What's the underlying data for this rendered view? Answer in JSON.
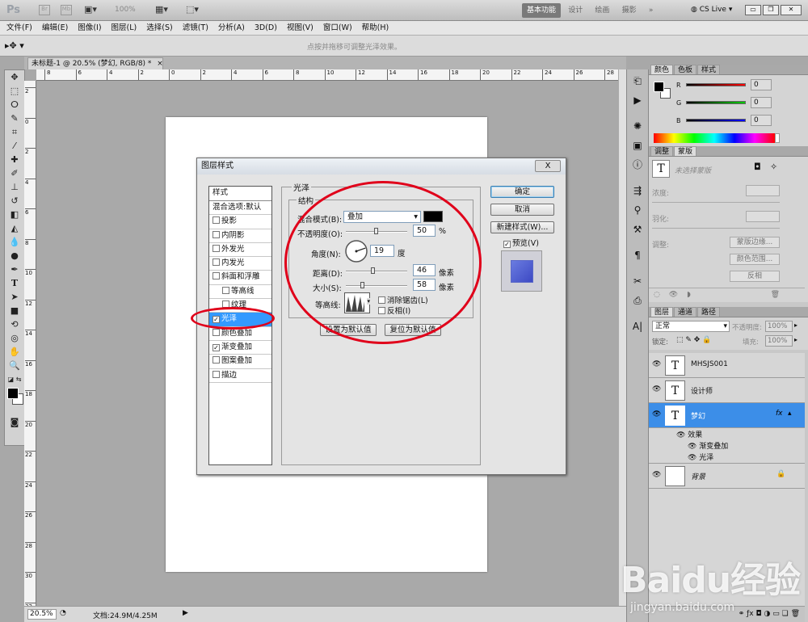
{
  "app": {
    "logo": "Ps",
    "zoom_display": "100%",
    "workspaces": [
      "基本功能",
      "设计",
      "绘画",
      "摄影"
    ],
    "more": "»",
    "cslive": "CS Live"
  },
  "menu": [
    "文件(F)",
    "编辑(E)",
    "图像(I)",
    "图层(L)",
    "选择(S)",
    "滤镜(T)",
    "分析(A)",
    "3D(D)",
    "视图(V)",
    "窗口(W)",
    "帮助(H)"
  ],
  "options": {
    "hint": "点按并拖移可调整光泽效果。"
  },
  "doc_tab": {
    "label": "未标题-1 @ 20.5% (梦幻, RGB/8) *",
    "close": "×"
  },
  "ruler": {
    "top": [
      "8",
      "6",
      "4",
      "2",
      "0",
      "2",
      "4",
      "6",
      "8",
      "10",
      "12",
      "14",
      "16",
      "18",
      "20",
      "22",
      "24",
      "26",
      "28"
    ],
    "left": [
      "2",
      "0",
      "2",
      "4",
      "6",
      "8",
      "10",
      "12",
      "14",
      "16",
      "18",
      "20",
      "22",
      "24",
      "26",
      "28",
      "30",
      "32"
    ]
  },
  "status": {
    "zoom": "20.5%",
    "doc": "文档:24.9M/4.25M"
  },
  "color_panel": {
    "tabs": [
      "颜色",
      "色板",
      "样式"
    ],
    "channels": [
      {
        "label": "R",
        "value": "0"
      },
      {
        "label": "G",
        "value": "0"
      },
      {
        "label": "B",
        "value": "0"
      }
    ]
  },
  "adjust_panel": {
    "tabs": [
      "调整",
      "蒙版"
    ],
    "mask_hint": "未选择蒙版",
    "density": "浓度:",
    "feather": "羽化:",
    "refine": "调整:",
    "buttons": [
      "蒙版边缘...",
      "颜色范围...",
      "反相"
    ]
  },
  "layers_panel": {
    "tabs": [
      "图层",
      "通道",
      "路径"
    ],
    "blend": "正常",
    "opacity_label": "不透明度:",
    "opacity": "100%",
    "lock_label": "锁定:",
    "fill_label": "填充:",
    "fill": "100%",
    "layers": [
      {
        "name": "MHSJS001",
        "thumb": "T"
      },
      {
        "name": "设计师",
        "thumb": "T"
      },
      {
        "name": "梦幻",
        "thumb": "T",
        "fx": "fx"
      }
    ],
    "effects_label": "效果",
    "effects": [
      "渐变叠加",
      "光泽"
    ],
    "background": "背景"
  },
  "dialog": {
    "title": "图层样式",
    "close": "X",
    "styles_header": "样式",
    "blend_options": "混合选项:默认",
    "styles": [
      {
        "label": "投影",
        "checked": false
      },
      {
        "label": "内阴影",
        "checked": false
      },
      {
        "label": "外发光",
        "checked": false
      },
      {
        "label": "内发光",
        "checked": false
      },
      {
        "label": "斜面和浮雕",
        "checked": false
      },
      {
        "label": "等高线",
        "checked": false,
        "indent": true
      },
      {
        "label": "纹理",
        "checked": false,
        "indent": true
      },
      {
        "label": "光泽",
        "checked": true,
        "selected": true
      },
      {
        "label": "颜色叠加",
        "checked": false
      },
      {
        "label": "渐变叠加",
        "checked": true
      },
      {
        "label": "图案叠加",
        "checked": false
      },
      {
        "label": "描边",
        "checked": false
      }
    ],
    "satin": {
      "title": "光泽",
      "structure": "结构",
      "blend_mode_label": "混合模式(B):",
      "blend_mode": "叠加",
      "opacity_label": "不透明度(O):",
      "opacity": "50",
      "opacity_level": 0.5,
      "opacity_unit": "%",
      "angle_label": "角度(N):",
      "angle": "19",
      "angle_unit": "度",
      "distance_label": "距离(D):",
      "distance": "46",
      "distance_unit": "像素",
      "size_label": "大小(S):",
      "size": "58",
      "size_unit": "像素",
      "contour_label": "等高线:",
      "antialias": "消除锯齿(L)",
      "invert": "反相(I)",
      "set_default": "设置为默认值",
      "reset_default": "复位为默认值"
    },
    "buttons": {
      "ok": "确定",
      "cancel": "取消",
      "new_style": "新建样式(W)...",
      "preview": "预览(V)"
    }
  },
  "watermark": {
    "brand": "Baidu经验",
    "url": "jingyan.baidu.com"
  },
  "colors": {
    "accent": "#3399ff",
    "annotation": "#e0001a"
  }
}
